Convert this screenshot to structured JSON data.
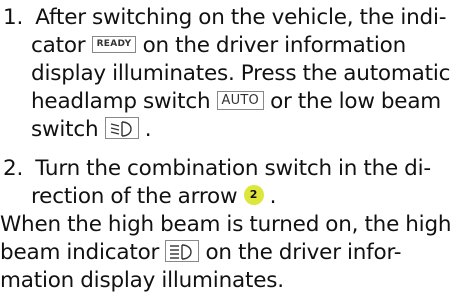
{
  "step1": {
    "number": "1.",
    "line1": "After switching on the vehicle, the indi-",
    "line2_pre": "cator",
    "ready_badge": "READY",
    "line2_post": "on the driver information",
    "line3": "display illuminates. Press the automatic",
    "line4_pre": "headlamp switch",
    "auto_badge": "AUTO",
    "line4_post": "or the low beam",
    "line5_pre": "switch",
    "low_beam_icon": "low-beam-headlamp-icon",
    "line5_post": "."
  },
  "step2": {
    "number": "2.",
    "line1": "Turn the combination switch in the di-",
    "line2_pre": "rection of the arrow",
    "callout": "2",
    "line2_post": "."
  },
  "note": {
    "line1": "When the high beam is turned on, the high",
    "line2_pre": "beam indicator",
    "high_beam_icon": "high-beam-indicator-icon",
    "line2_post": "on the driver infor-",
    "line3": "mation display illuminates."
  },
  "colors": {
    "callout": "#dde63a",
    "badge_border": "#888888",
    "text": "#111111"
  }
}
